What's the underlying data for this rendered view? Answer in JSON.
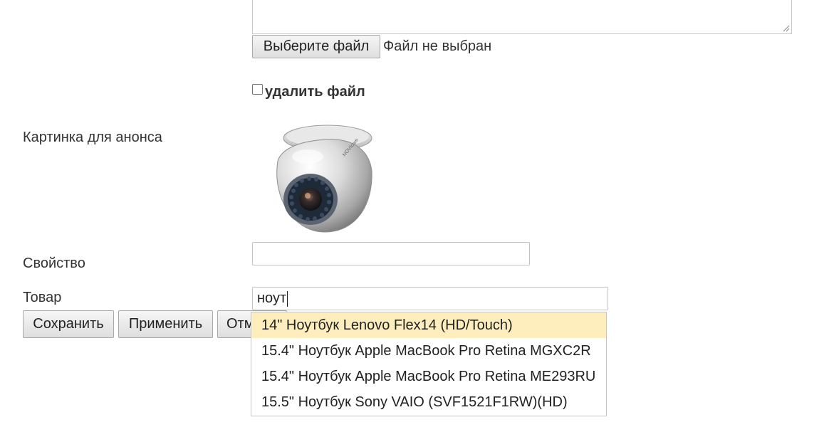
{
  "description": {
    "file_button_label": "Выберите файл",
    "file_status": "Файл не выбран",
    "delete_file_label": "удалить файл"
  },
  "preview_image": {
    "label": "Картинка для анонса",
    "brand_text": "NOVIcam"
  },
  "property": {
    "label": "Свойство",
    "value": ""
  },
  "product": {
    "label": "Товар",
    "value": "ноут"
  },
  "autocomplete": {
    "items": [
      "14\" Ноутбук Lenovo Flex14 (HD/Touch)",
      "15.4\" Ноутбук Apple MacBook Pro Retina MGXC2R",
      "15.4\" Ноутбук Apple MacBook Pro Retina ME293RU",
      "15.5\" Ноутбук Sony VAIO (SVF1521F1RW)(HD)"
    ],
    "highlight_color": "#feeebd"
  },
  "actions": {
    "save_label": "Сохранить",
    "apply_label": "Применить",
    "cancel_label": "Отм"
  }
}
